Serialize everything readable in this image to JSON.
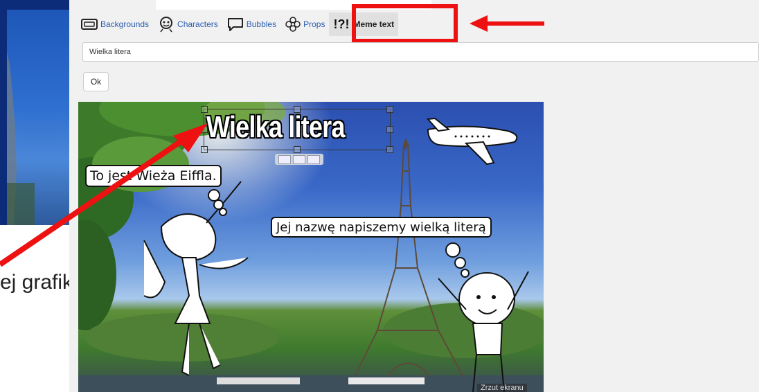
{
  "slide": {
    "caption": "ej grafiki."
  },
  "toolbar": {
    "items": [
      {
        "label": "Backgrounds",
        "icon": "background-icon"
      },
      {
        "label": "Characters",
        "icon": "character-icon"
      },
      {
        "label": "Bubbles",
        "icon": "speech-bubble-icon"
      },
      {
        "label": "Props",
        "icon": "flower-icon"
      },
      {
        "label": "Meme text",
        "icon": "meme-text-icon",
        "icon_text": "!?!",
        "active": true
      }
    ]
  },
  "editor": {
    "text_value": "Wielka litera",
    "ok_label": "Ok"
  },
  "comic": {
    "meme_title": "Wielka litera",
    "bubble1": "To jest Wieża Eiffla.",
    "bubble2": "Jej nazwę napiszemy wielką literą",
    "watermark": "Zrzut ekranu"
  },
  "colors": {
    "annotation_red": "#ee1111",
    "link_blue": "#2a5db0",
    "app_background": "#f1f1f1"
  }
}
